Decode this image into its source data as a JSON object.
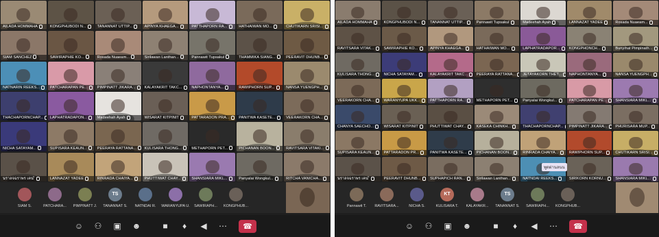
{
  "left_panel": {
    "tiles": [
      {
        "name": "AILADA HOMMAHA",
        "bg": "#9a8a74"
      },
      {
        "name": "KONGPHUBODI N...",
        "bg": "#5d5346"
      },
      {
        "name": "TANANNAT UTTIP...",
        "bg": "#6b6055"
      },
      {
        "name": "APINYA KHAEGA...",
        "bg": "#b59a7d"
      },
      {
        "name": "PATTHAPORN RA...",
        "bg": "#c8b9d6"
      },
      {
        "name": "HATHAIWAN MO...",
        "bg": "#7a6a5a"
      },
      {
        "name": "CHUTIKARN SRISI...",
        "bg": "#c9b067"
      },
      {
        "name": "SIAM SANCHEZ",
        "bg": "#8b7768"
      },
      {
        "name": "SAWIRAPHIE KO...",
        "bg": "#6a5644"
      },
      {
        "name": "Rosada Nuaeam...",
        "bg": "#a98a78"
      },
      {
        "name": "Sirilawan Lanthan...",
        "bg": "#8e8173"
      },
      {
        "name": "Pannawit Tupsakul",
        "bg": "#77746a"
      },
      {
        "name": "THAMMIKA SIANG...",
        "bg": "#5c5248"
      },
      {
        "name": "PEERAVIT DHUNB...",
        "bg": "#6e5a44"
      },
      {
        "name": "NATNARIN REEKS...",
        "bg": "#4c8fb7"
      },
      {
        "name": "PATCHARAPAN PE...",
        "bg": "#d99aa8"
      },
      {
        "name": "PIMPINATT JIKARA...",
        "bg": "#8a8078"
      },
      {
        "name": "KALAYAKRIT TAKC...",
        "bg": "#3a3a3a"
      },
      {
        "name": "NAPHONTANYA...",
        "bg": "#8f6a9e"
      },
      {
        "name": "RAWIPHORN SUP...",
        "bg": "#b34a2a"
      },
      {
        "name": "NANSA YUENGPH...",
        "bg": "#9b8a6e"
      },
      {
        "name": "THACHAPORNCHAP...",
        "bg": "#3d3f6e"
      },
      {
        "name": "LAPHATRADAPON...",
        "bg": "#8a5aa0"
      },
      {
        "name": "Madeehah Ayah",
        "bg": "#e6e3df"
      },
      {
        "name": "WISARAT KITPINIT",
        "bg": "#6a5f56"
      },
      {
        "name": "PATTARADON PRA...",
        "bg": "#c99a48"
      },
      {
        "name": "PANITWA KASETE...",
        "bg": "#2e3b4a"
      },
      {
        "name": "VEERAKORN CHA...",
        "bg": "#7c6b5a"
      },
      {
        "name": "NICHA SATAYAM...",
        "bg": "#3a3a7a"
      },
      {
        "name": "SUPISARA KEAUN...",
        "bg": "#8d7a66"
      },
      {
        "name": "PEERAYA RATTANA...",
        "bg": "#7a6650"
      },
      {
        "name": "KULISARA THONG...",
        "bg": "#6f6a64"
      },
      {
        "name": "METHAPORN PET...",
        "bg": "#2a2a2a"
      },
      {
        "name": "PICHANAN BOON...",
        "bg": "#b8b29e"
      },
      {
        "name": "RAVITSARA VITAKI...",
        "bg": "#8a7d6c"
      },
      {
        "name": "นราลจฉราพร เคน ิ",
        "bg": "#5a5148"
      },
      {
        "name": "LANNAZAT YADEE",
        "bg": "#a88a5a"
      },
      {
        "name": "RINRADA CHAIYA...",
        "bg": "#c2a47a"
      },
      {
        "name": "PHUTTIWAT CHAY...",
        "bg": "#c9c3b8"
      },
      {
        "name": "SHANSIARA MIKL...",
        "bg": "#9a7ab0"
      },
      {
        "name": "Panyalai Wongkul...",
        "bg": "#6e6a62"
      },
      {
        "name": "RITCHA VANICHA...",
        "bg": "#8b7a6a"
      }
    ],
    "strip": [
      {
        "name": "SIAM S.",
        "initials": "",
        "color": "#a2565a"
      },
      {
        "name": "PATCHARA...",
        "initials": "",
        "color": "#8d6a8a"
      },
      {
        "name": "PIMPINATT J.",
        "initials": "",
        "color": "#7b7f52"
      },
      {
        "name": "TANANNAT S.",
        "initials": "TS",
        "color": "#6c7c8c"
      },
      {
        "name": "NATNDAI R.",
        "initials": "",
        "color": "#5a6f8a"
      },
      {
        "name": "WARANYUPA U.",
        "initials": "",
        "color": "#8c6fa8"
      },
      {
        "name": "SAWIRAPH...",
        "initials": "",
        "color": "#6d7a5a"
      },
      {
        "name": "KONGPHUB...",
        "initials": "",
        "color": "#6a6058"
      }
    ]
  },
  "right_panel": {
    "tiles": [
      {
        "name": "AILADA HOMMAHA",
        "bg": "#8a7c6e"
      },
      {
        "name": "KONGPHUBODI N...",
        "bg": "#5b5247"
      },
      {
        "name": "TANANNAT UTTIP...",
        "bg": "#6a6056"
      },
      {
        "name": "Pannawit Tupsakul",
        "bg": "#8c7a66"
      },
      {
        "name": "Madeehah Ayah",
        "bg": "#dcd8d2"
      },
      {
        "name": "LANNAZAT YADEE",
        "bg": "#a08a6a"
      },
      {
        "name": "Rosada Nuaeam...",
        "bg": "#a48a78"
      },
      {
        "name": "RAVITSARA VITAK...",
        "bg": "#5e5246"
      },
      {
        "name": "SAWIRAPHIE KO...",
        "bg": "#6b5a48"
      },
      {
        "name": "APINYA KHAEGA...",
        "bg": "#b1987e"
      },
      {
        "name": "HATHAIWAN MO...",
        "bg": "#7a6a5a"
      },
      {
        "name": "LAPHATRADAPOR...",
        "bg": "#8a5a98"
      },
      {
        "name": "KONGPHONCH...",
        "bg": "#8a8274"
      },
      {
        "name": "Bunyihat Pimpinath...",
        "bg": "#a2987e"
      },
      {
        "name": "KULISARA THONG...",
        "bg": "#6f6a62"
      },
      {
        "name": "NICHA SATAYAM...",
        "bg": "#3c3c78"
      },
      {
        "name": "KALAYAKRIT TAKC...",
        "bg": "#b46a8a"
      },
      {
        "name": "PEERAYA RATTANA...",
        "bg": "#7b6652"
      },
      {
        "name": "JETAYAKORN THET...",
        "bg": "#c9c7b8"
      },
      {
        "name": "NAPHONTANYA...",
        "bg": "#9a6a7c"
      },
      {
        "name": "NANSA YUENGPH...",
        "bg": "#9a896c"
      },
      {
        "name": "VEERAKORN CHA...",
        "bg": "#7c6a58"
      },
      {
        "name": "WARANYUPA UKK...",
        "bg": "#c9a64a"
      },
      {
        "name": "PATTHAPORN RA...",
        "bg": "#b2a0c2"
      },
      {
        "name": "METHAPORN PET...",
        "bg": "#2e2e2e"
      },
      {
        "name": "Panyalai Wongkul...",
        "bg": "#6d6a60"
      },
      {
        "name": "PATCHARAPAN PE...",
        "bg": "#d89aa6"
      },
      {
        "name": "SHANSIARA MIKL...",
        "bg": "#9c7ab0"
      },
      {
        "name": "CHANYA SAECHO...",
        "bg": "#3a4a6a"
      },
      {
        "name": "WISARAT KITPINIT",
        "bg": "#6a6054"
      },
      {
        "name": "PHUTTIWAT CHAY...",
        "bg": "#5a4f44"
      },
      {
        "name": "KASEKA CHINKH...",
        "bg": "#9b8a78"
      },
      {
        "name": "THACHAPORNCHAP...",
        "bg": "#404070"
      },
      {
        "name": "PIMPINATT JIKARA...",
        "bg": "#847a72"
      },
      {
        "name": "PHURISARA MUP...",
        "bg": "#7b6e62"
      },
      {
        "name": "SUPISARA KEAUN...",
        "bg": "#8b7864"
      },
      {
        "name": "PATTARADON PR...",
        "bg": "#c89a46"
      },
      {
        "name": "PANITWA KASETE...",
        "bg": "#2f3c4a"
      },
      {
        "name": "PICHANAN BOON...",
        "bg": "#b6b09c"
      },
      {
        "name": "RINRADA CHAIYA...",
        "bg": "#c0a278"
      },
      {
        "name": "RAWIPHORN SUP...",
        "bg": "#b24a2c"
      },
      {
        "name": "CHUTIKARN SRISI...",
        "bg": "#c7ae66"
      },
      {
        "name": "นราลจฉราพร เคน ิ",
        "bg": "#5b5249"
      },
      {
        "name": "PEERAVIT DHUNB...",
        "bg": "#6e5a46"
      },
      {
        "name": "SUPHAPICH RAN...",
        "bg": "#7a6d60"
      },
      {
        "name": "Sirilawan Lanthan...",
        "bg": "#8c8072"
      },
      {
        "name": "NATNDAI REEKS...",
        "bg": "#4d8fb4"
      },
      {
        "name": "SIRIKORN KORNU...",
        "bg": "#6a6258"
      },
      {
        "name": "SHANSIARA MIKL...",
        "bg": "#9a7aae"
      }
    ],
    "strip": [
      {
        "name": "Pannawit T.",
        "initials": "",
        "color": "#7c6a58"
      },
      {
        "name": "RAVITSARA...",
        "initials": "",
        "color": "#8a6a5a"
      },
      {
        "name": "NICHA S.",
        "initials": "",
        "color": "#5a5a8a"
      },
      {
        "name": "KULISARA T.",
        "initials": "KT",
        "color": "#b56a5a"
      },
      {
        "name": "KALAYAKR...",
        "initials": "",
        "color": "#a87a8a"
      },
      {
        "name": "TANANNAT S.",
        "initials": "TS",
        "color": "#6c7c8c"
      },
      {
        "name": "SAWIRAPH...",
        "initials": "",
        "color": "#6d7a5a"
      },
      {
        "name": "KONGPHUB...",
        "initials": "",
        "color": "#6a6058"
      }
    ]
  },
  "controls": [
    "chat-icon",
    "people-icon",
    "share-icon",
    "reactions-icon",
    "camera-icon",
    "mic-icon",
    "speaker-icon",
    "more-icon"
  ],
  "control_glyphs": {
    "chat-icon": "☺",
    "people-icon": "⚇",
    "share-icon": "▣",
    "reactions-icon": "☻",
    "camera-icon": "■",
    "mic-icon": "♦",
    "speaker-icon": "◀",
    "more-icon": "⋯"
  },
  "leave_glyph": "☎",
  "accent_red": "#c4314b",
  "overlay_label": "พูดผ่านลนน"
}
